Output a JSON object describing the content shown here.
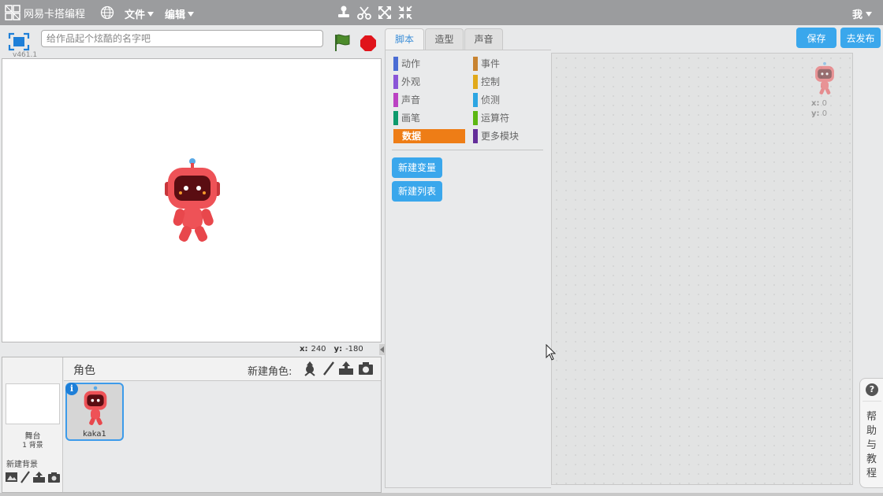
{
  "app": {
    "title": "网易卡搭编程",
    "menu_file": "文件",
    "menu_edit": "编辑",
    "user_menu": "我"
  },
  "header": {
    "save_label": "保存",
    "publish_label": "去发布"
  },
  "stage": {
    "version": "v461.1",
    "project_name_placeholder": "给作品起个炫酷的名字吧",
    "project_name_value": "",
    "coords": {
      "x_label": "x:",
      "x_value": "240",
      "y_label": "y:",
      "y_value": "-180"
    }
  },
  "sprite_panel": {
    "title": "角色",
    "new_sprite_label": "新建角色:",
    "stage_label": "舞台",
    "stage_backdrops": "1 背景",
    "new_backdrop_label": "新建背景",
    "sprites": [
      {
        "name": "kaka1",
        "info_icon": "i"
      }
    ]
  },
  "tabs": [
    {
      "label": "脚本",
      "active": true
    },
    {
      "label": "造型",
      "active": false
    },
    {
      "label": "声音",
      "active": false
    }
  ],
  "palette": {
    "categories_left": [
      {
        "label": "动作",
        "color": "#4a6cd4"
      },
      {
        "label": "外观",
        "color": "#8a55d7"
      },
      {
        "label": "声音",
        "color": "#bb42c3"
      },
      {
        "label": "画笔",
        "color": "#0e9a6c"
      },
      {
        "label": "数据",
        "color": "#ee7d16",
        "selected": true
      }
    ],
    "categories_right": [
      {
        "label": "事件",
        "color": "#c88330"
      },
      {
        "label": "控制",
        "color": "#e1a91a"
      },
      {
        "label": "侦测",
        "color": "#2ca5e2"
      },
      {
        "label": "运算符",
        "color": "#5cb712"
      },
      {
        "label": "更多模块",
        "color": "#632d99"
      }
    ],
    "buttons": {
      "new_variable": "新建变量",
      "new_list": "新建列表"
    }
  },
  "scripts": {
    "sprite_x_label": "x:",
    "sprite_x": "0",
    "sprite_y_label": "y:",
    "sprite_y": "0"
  },
  "help": {
    "q": "?",
    "label": "帮助与教程"
  },
  "colors": {
    "accent": "#3aa7ec",
    "topbar": "#9b9c9e",
    "sprite_red": "#e8474c"
  }
}
